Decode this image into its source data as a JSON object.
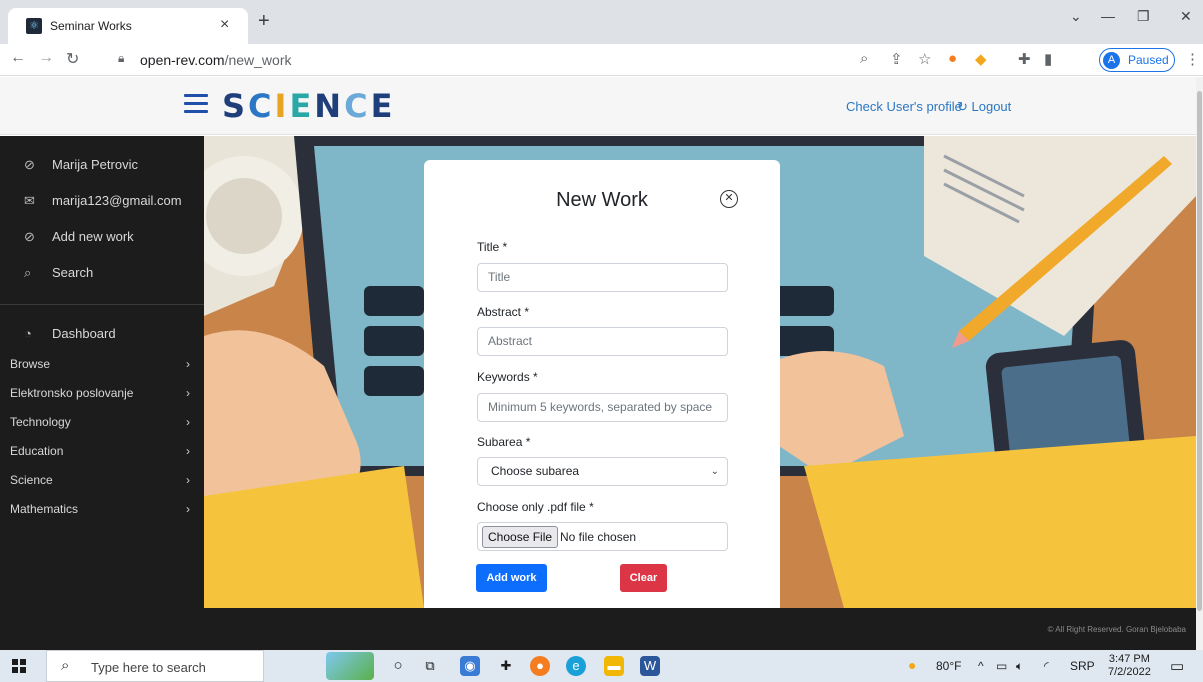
{
  "browser": {
    "tab_title": "Seminar Works",
    "url_host": "open-rev.com",
    "url_path": "/new_work",
    "profile_initial": "A",
    "profile_status": "Paused"
  },
  "header": {
    "logo_letters": [
      "S",
      "C",
      "I",
      "E",
      "N",
      "C",
      "E"
    ],
    "profile_link": "Check User's profile",
    "logout_link": "Logout"
  },
  "sidebar": {
    "user_name": "Marija Petrovic",
    "user_email": "marija123@gmail.com",
    "add_work": "Add new work",
    "search": "Search",
    "dashboard": "Dashboard",
    "categories": [
      "Browse",
      "Elektronsko poslovanje",
      "Technology",
      "Education",
      "Science",
      "Mathematics"
    ]
  },
  "modal": {
    "title": "New Work",
    "title_label": "Title *",
    "title_placeholder": "Title",
    "abstract_label": "Abstract *",
    "abstract_placeholder": "Abstract",
    "keywords_label": "Keywords *",
    "keywords_placeholder": "Minimum 5 keywords, separated by space",
    "subarea_label": "Subarea *",
    "subarea_selected": "Choose subarea",
    "file_label": "Choose only .pdf file *",
    "file_button": "Choose File",
    "file_status": "No file chosen",
    "add_button": "Add work",
    "clear_button": "Clear"
  },
  "footer": {
    "copyright": "© All Right Reserved. Goran Bjelobaba"
  },
  "taskbar": {
    "search_text": "Type here to search",
    "weather": "80°F",
    "language": "SRP",
    "time": "3:47 PM",
    "date": "7/2/2022"
  }
}
